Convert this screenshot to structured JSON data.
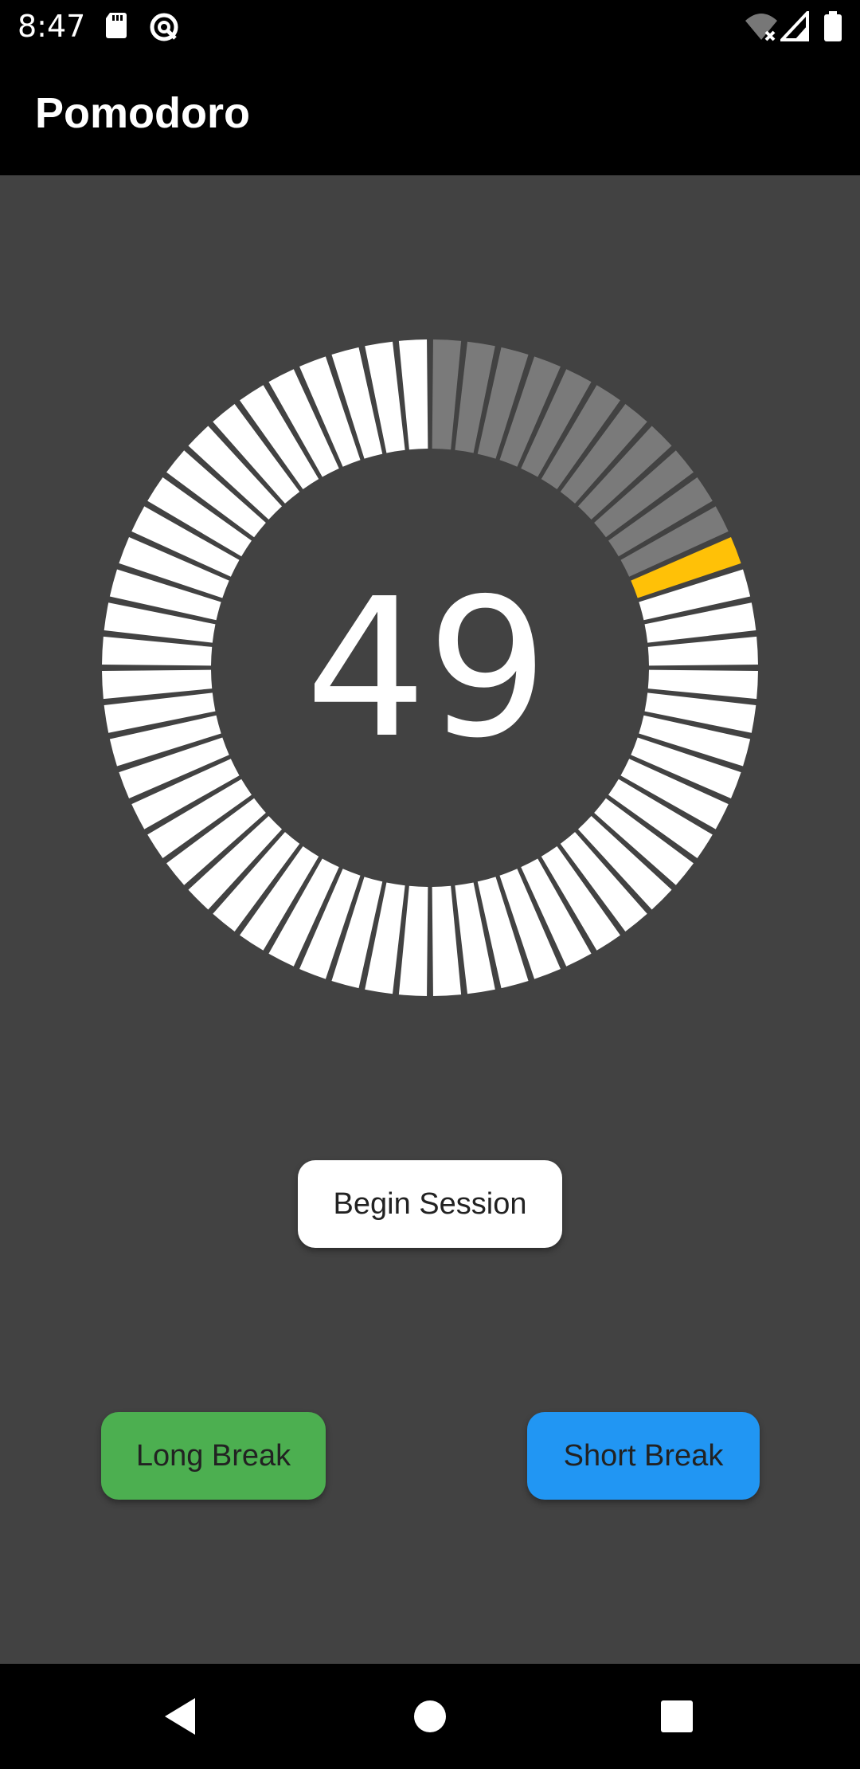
{
  "status_bar": {
    "time": "8:47",
    "icons": [
      "sd-card-icon",
      "sync-icon",
      "wifi-no-internet-icon",
      "cellular-signal-icon",
      "battery-icon"
    ]
  },
  "app_bar": {
    "title": "Pomodoro"
  },
  "timer": {
    "value": "49",
    "total_segments": 60,
    "elapsed_segments": 11,
    "current_segment_index": 11,
    "colors": {
      "remaining": "#FFFFFF",
      "elapsed": "#7A7A7A",
      "current": "#FFC107"
    }
  },
  "actions": {
    "begin_label": "Begin Session",
    "long_break_label": "Long Break",
    "short_break_label": "Short Break",
    "long_break_color": "#4CAF50",
    "short_break_color": "#2196F3"
  },
  "nav_bar": {
    "icons": [
      "back-icon",
      "home-icon",
      "recents-icon"
    ]
  }
}
